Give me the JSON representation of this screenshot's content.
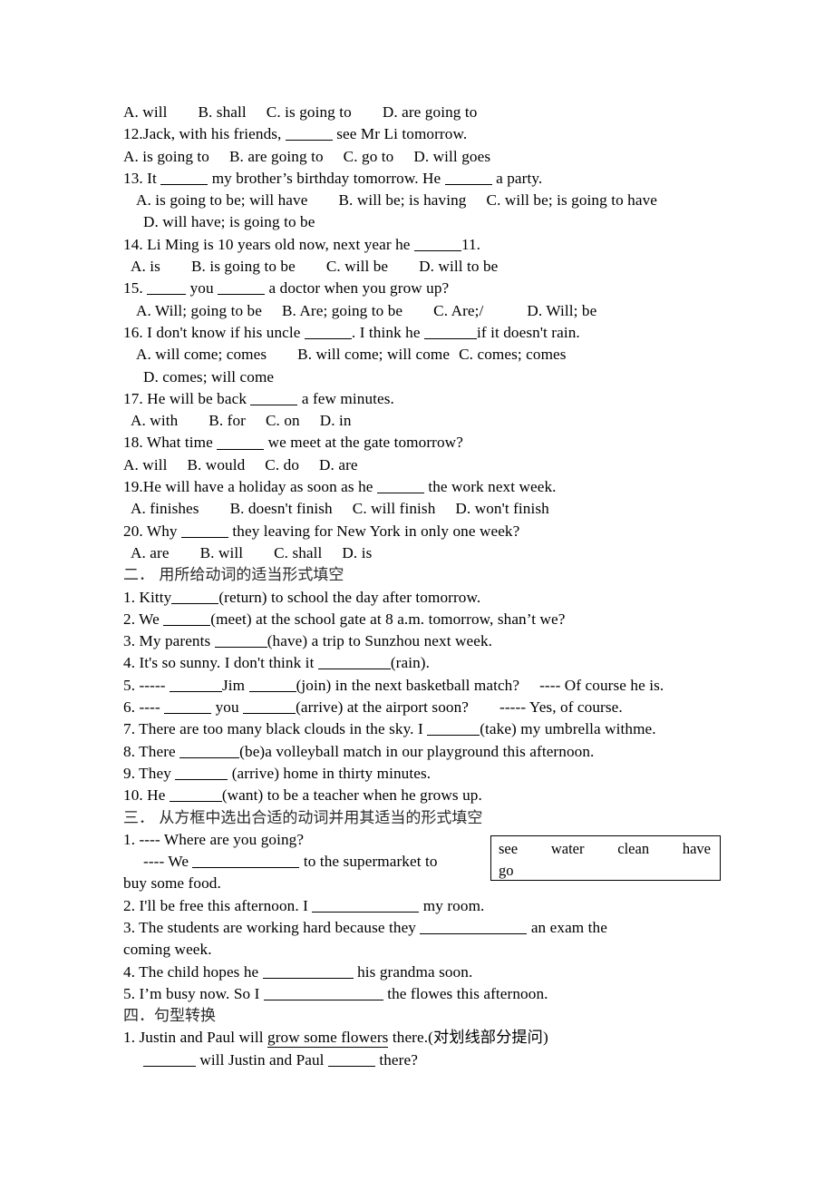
{
  "document": {
    "type": "grammar-worksheet",
    "language": "en-zh"
  },
  "section_one_tail": {
    "q11_options": {
      "a": "A. will",
      "b": "B. shall",
      "c": "C. is going to",
      "d": "D. are going to"
    },
    "q12": {
      "stem_before": "12.Jack, with his friends,",
      "stem_after": "see Mr Li tomorrow.",
      "a": "A. is going to",
      "b": "B. are going to",
      "c": "C. go to",
      "d": "D. will goes"
    },
    "q13": {
      "stem_a": "13. It",
      "stem_b": "my brother’s birthday tomorrow. He",
      "stem_c": "a party.",
      "a": "A. is going to be; will have",
      "b": "B. will be; is having",
      "c": "C. will be; is going to have",
      "d": "D. will have; is going to be"
    },
    "q14": {
      "stem_a": "14. Li Ming is 10 years old now, next year he",
      "stem_b": "11.",
      "a": "A. is",
      "b": "B. is going to be",
      "c": "C. will be",
      "d": "D. will to be"
    },
    "q15": {
      "stem_a": "15.",
      "stem_b": "you",
      "stem_c": "a doctor when you grow up?",
      "a": "A. Will;   going to be",
      "b": "B. Are; going to be",
      "c": "C. Are;/",
      "d": "D. Will; be"
    },
    "q16": {
      "stem_a": "16. I don't know if his uncle",
      "stem_b": ". I think he",
      "stem_c": "if it doesn't rain.",
      "a": "A. will come; comes",
      "b": "B. will come; will come",
      "c": "C. comes; comes",
      "d": "D. comes; will come"
    },
    "q17": {
      "stem_a": "17. He will be back",
      "stem_b": "a few minutes.",
      "a": "A. with",
      "b": "B. for",
      "c": "C. on",
      "d": "D. in"
    },
    "q18": {
      "stem_a": "18. What time",
      "stem_b": "we meet at the gate tomorrow?",
      "a": "A. will",
      "b": "B. would",
      "c": "C. do",
      "d": "D. are"
    },
    "q19": {
      "stem_a": "19.He will have a holiday as soon as he",
      "stem_b": "the work next week.",
      "a": "A. finishes",
      "b": "B. doesn't finish",
      "c": "C. will finish",
      "d": "D. won't finish"
    },
    "q20": {
      "stem_a": "20. Why",
      "stem_b": "they leaving for New York in only one week?",
      "a": "A. are",
      "b": "B. will",
      "c": "C. shall",
      "d": "D. is"
    }
  },
  "section_two": {
    "heading": "二．  用所给动词的适当形式填空",
    "items": {
      "q1_a": "1. Kitty",
      "q1_b": "(return) to school the day after tomorrow.",
      "q2_a": "2. We",
      "q2_b": "(meet) at the school gate at 8 a.m. tomorrow, shan’t we?",
      "q3_a": "3. My parents",
      "q3_b": "(have) a trip to Sunzhou next week.",
      "q4_a": "4. It's so sunny. I don't think it",
      "q4_b": "(rain).",
      "q5_a": "5. -----",
      "q5_b": "Jim",
      "q5_c": "(join) in the next basketball match?",
      "q5_d": "---- Of course he is.",
      "q6_a": "6. ----",
      "q6_b": "you",
      "q6_c": "(arrive) at the airport soon?",
      "q6_d": "----- Yes, of course.",
      "q7_a": "7. There are too many black clouds in the sky. I",
      "q7_b": "(take) my umbrella withme.",
      "q8_a": "8. There",
      "q8_b": "(be)a volleyball match in our playground this afternoon.",
      "q9_a": "9. They",
      "q9_b": "(arrive) home in thirty minutes.",
      "q10_a": "10. He",
      "q10_b": "(want) to be a teacher when he grows up."
    }
  },
  "section_three": {
    "heading": "三． 从方框中选出合适的动词并用其适当的形式填空",
    "word_bank": {
      "row1": [
        "see",
        "water",
        "clean",
        "have"
      ],
      "row2": [
        "go"
      ]
    },
    "items": {
      "q1_l1": "1. ---- Where are you going?",
      "q1_l2a": "---- We",
      "q1_l2b": "to the supermarket to",
      "q1_l3": "buy some food.",
      "q2_a": "2. I'll be free this afternoon. I",
      "q2_b": "my room.",
      "q3_a": "3. The students are working hard because they",
      "q3_b": "an exam the",
      "q3_c": "coming week.",
      "q4_a": "4. The child hopes he",
      "q4_b": "his grandma soon.",
      "q5_a": "5. I’m busy now. So I",
      "q5_b": "the flowes this afternoon."
    }
  },
  "section_four": {
    "heading": "四．句型转换",
    "items": {
      "q1_a": "1. Justin and Paul will",
      "q1_underlined": "grow some flowers",
      "q1_b": "there.(对划线部分提问)",
      "q1_ans_a": "will Justin and Paul",
      "q1_ans_b": "there?"
    }
  }
}
